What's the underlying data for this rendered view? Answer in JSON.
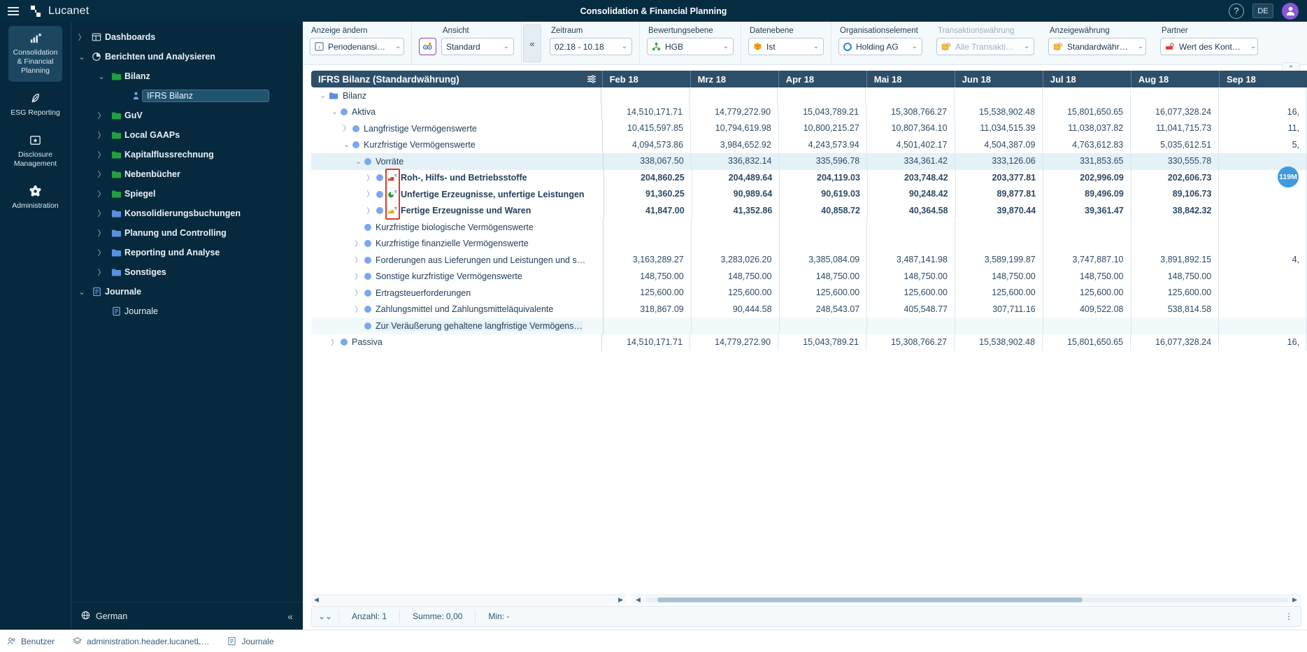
{
  "topbar": {
    "brand": "Lucanet",
    "title": "Consolidation & Financial Planning",
    "help_icon": "question-mark-icon",
    "language": "DE",
    "avatar_icon": "user-avatar-icon",
    "menu_icon": "hamburger-menu-icon"
  },
  "rail": {
    "items": [
      {
        "label": "Consolidation & Financial Planning",
        "icon": "bar-chart-icon",
        "active": true
      },
      {
        "label": "ESG Reporting",
        "icon": "leaf-icon",
        "active": false
      },
      {
        "label": "Disclosure Management",
        "icon": "document-star-icon",
        "active": false
      },
      {
        "label": "Administration",
        "icon": "gear-icon",
        "active": false
      }
    ]
  },
  "nav": {
    "items": [
      {
        "label": "Dashboards",
        "level": 1,
        "twisty": "right",
        "icon": "dashboard-icon"
      },
      {
        "label": "Berichten und Analysieren",
        "level": 1,
        "twisty": "down",
        "icon": "clock-pie-icon"
      },
      {
        "label": "Bilanz",
        "level": 2,
        "twisty": "down",
        "icon": "folder-green-icon"
      },
      {
        "label": "IFRS Bilanz",
        "level": 3,
        "twisty": "none",
        "icon": "report-person-icon",
        "selected": true
      },
      {
        "label": "GuV",
        "level": 2,
        "twisty": "right",
        "icon": "folder-green-icon"
      },
      {
        "label": "Local GAAPs",
        "level": 2,
        "twisty": "right",
        "icon": "folder-green-icon"
      },
      {
        "label": "Kapitalflussrechnung",
        "level": 2,
        "twisty": "right",
        "icon": "folder-green-icon"
      },
      {
        "label": "Nebenbücher",
        "level": 2,
        "twisty": "right",
        "icon": "folder-green-icon"
      },
      {
        "label": "Spiegel",
        "level": 2,
        "twisty": "right",
        "icon": "folder-green-icon"
      },
      {
        "label": "Konsolidierungsbuchungen",
        "level": 2,
        "twisty": "right",
        "icon": "folder-blue-icon"
      },
      {
        "label": "Planung und Controlling",
        "level": 2,
        "twisty": "right",
        "icon": "folder-blue-icon"
      },
      {
        "label": "Reporting und Analyse",
        "level": 2,
        "twisty": "right",
        "icon": "folder-blue-icon"
      },
      {
        "label": "Sonstiges",
        "level": 2,
        "twisty": "right",
        "icon": "folder-blue-icon"
      },
      {
        "label": "Journale",
        "level": 1,
        "twisty": "down",
        "icon": "journal-icon"
      },
      {
        "label": "Journale",
        "level": 2,
        "twisty": "none",
        "icon": "journal-icon",
        "leaf": true
      }
    ],
    "footer": {
      "language": "German",
      "globe_icon": "globe-icon",
      "collapse_icon": "collapse-left-icon"
    }
  },
  "toolbar": {
    "groups": [
      {
        "label": "Anzeige ändern",
        "value": "Periodenansi…",
        "icon": "table-t-icon",
        "dim": false
      },
      {
        "label": "Ansicht",
        "value": "Standard",
        "icon": "none",
        "dim": false,
        "extra_button": "view-settings-icon"
      },
      {
        "label": "Zeitraum",
        "value": "02.18 - 10.18",
        "icon": "none",
        "dim": false
      },
      {
        "label": "Bewertungsebene",
        "value": "HGB",
        "icon": "hierarchy-green-icon",
        "dim": false
      },
      {
        "label": "Datenebene",
        "value": "Ist",
        "icon": "cube-orange-icon",
        "dim": false
      },
      {
        "label": "Organisationselement",
        "value": "Holding AG",
        "icon": "circle-blue-icon",
        "dim": false
      },
      {
        "label": "Transaktionswährung",
        "value": "Alle Transakti…",
        "icon": "coins-icon",
        "dim": true
      },
      {
        "label": "Anzeigewährung",
        "value": "Standardwähr…",
        "icon": "coins-icon",
        "dim": false
      },
      {
        "label": "Partner",
        "value": "Wert des Kont…",
        "icon": "partner-red-icon",
        "dim": false
      }
    ],
    "collapse_icon": "collapse-left-icon"
  },
  "grid": {
    "tree_header": "IFRS Bilanz (Standardwährung)",
    "filter_icon": "column-settings-icon",
    "scroll_up_icon": "chevron-up-icon",
    "columns": [
      "Feb 18",
      "Mrz 18",
      "Apr 18",
      "Mai 18",
      "Jun 18",
      "Jul 18",
      "Aug 18",
      "Sep 18"
    ],
    "badge": "119M",
    "rows": [
      {
        "label": "Bilanz",
        "indent": 0,
        "twisty": "down",
        "marker": "folder",
        "bold": false,
        "values": [
          "",
          "",
          "",
          "",
          "",
          "",
          "",
          ""
        ]
      },
      {
        "label": "Aktiva",
        "indent": 1,
        "twisty": "down",
        "marker": "dot",
        "bold": false,
        "values": [
          "14,510,171.71",
          "14,779,272.90",
          "15,043,789.21",
          "15,308,766.27",
          "15,538,902.48",
          "15,801,650.65",
          "16,077,328.24",
          "16,"
        ]
      },
      {
        "label": "Langfristige Vermögenswerte",
        "indent": 2,
        "twisty": "right",
        "marker": "dot",
        "bold": false,
        "values": [
          "10,415,597.85",
          "10,794,619.98",
          "10,800,215.27",
          "10,807,364.10",
          "11,034,515.39",
          "11,038,037.82",
          "11,041,715.73",
          "11,"
        ]
      },
      {
        "label": "Kurzfristige Vermögenswerte",
        "indent": 2,
        "twisty": "down",
        "marker": "dot",
        "bold": false,
        "values": [
          "4,094,573.86",
          "3,984,652.92",
          "4,243,573.94",
          "4,501,402.17",
          "4,504,387.09",
          "4,763,612.83",
          "5,035,612.51",
          "5,"
        ]
      },
      {
        "label": "Vorräte",
        "indent": 3,
        "twisty": "down",
        "marker": "dot",
        "bold": false,
        "highlight": true,
        "values": [
          "338,067.50",
          "336,832.14",
          "335,596.78",
          "334,361.42",
          "333,126.06",
          "331,853.65",
          "330,555.78",
          ""
        ]
      },
      {
        "label": "Roh-, Hilfs- und Betriebsstoffe",
        "indent": 4,
        "twisty": "right",
        "marker": "dot",
        "mini": "chart-red-icon",
        "bold": true,
        "values": [
          "204,860.25",
          "204,489.64",
          "204,119.03",
          "203,748.42",
          "203,377.81",
          "202,996.09",
          "202,606.73",
          ""
        ]
      },
      {
        "label": "Unfertige Erzeugnisse, unfertige Leistungen",
        "indent": 4,
        "twisty": "right",
        "marker": "dot",
        "mini": "chart-green-icon",
        "bold": true,
        "values": [
          "91,360.25",
          "90,989.64",
          "90,619.03",
          "90,248.42",
          "89,877.81",
          "89,496.09",
          "89,106.73",
          ""
        ]
      },
      {
        "label": "Fertige Erzeugnisse und Waren",
        "indent": 4,
        "twisty": "right",
        "marker": "dot",
        "mini": "chart-orange-icon",
        "bold": true,
        "values": [
          "41,847.00",
          "41,352.86",
          "40,858.72",
          "40,364.58",
          "39,870.44",
          "39,361.47",
          "38,842.32",
          ""
        ]
      },
      {
        "label": "Kurzfristige biologische Vermögenswerte",
        "indent": 3,
        "twisty": "none",
        "marker": "dot",
        "bold": false,
        "values": [
          "",
          "",
          "",
          "",
          "",
          "",
          "",
          ""
        ]
      },
      {
        "label": "Kurzfristige finanzielle Vermögenswerte",
        "indent": 3,
        "twisty": "right",
        "marker": "dot",
        "bold": false,
        "values": [
          "",
          "",
          "",
          "",
          "",
          "",
          "",
          ""
        ]
      },
      {
        "label": "Forderungen aus Lieferungen und Leistungen und s…",
        "indent": 3,
        "twisty": "right",
        "marker": "dot",
        "bold": false,
        "values": [
          "3,163,289.27",
          "3,283,026.20",
          "3,385,084.09",
          "3,487,141.98",
          "3,589,199.87",
          "3,747,887.10",
          "3,891,892.15",
          "4,"
        ]
      },
      {
        "label": "Sonstige kurzfristige Vermögenswerte",
        "indent": 3,
        "twisty": "right",
        "marker": "dot",
        "bold": false,
        "values": [
          "148,750.00",
          "148,750.00",
          "148,750.00",
          "148,750.00",
          "148,750.00",
          "148,750.00",
          "148,750.00",
          ""
        ]
      },
      {
        "label": "Ertragsteuerforderungen",
        "indent": 3,
        "twisty": "right",
        "marker": "dot",
        "bold": false,
        "values": [
          "125,600.00",
          "125,600.00",
          "125,600.00",
          "125,600.00",
          "125,600.00",
          "125,600.00",
          "125,600.00",
          ""
        ]
      },
      {
        "label": "Zahlungsmittel und Zahlungsmitteläquivalente",
        "indent": 3,
        "twisty": "right",
        "marker": "dot",
        "bold": false,
        "values": [
          "318,867.09",
          "90,444.58",
          "248,543.07",
          "405,548.77",
          "307,711.16",
          "409,522.08",
          "538,814.58",
          ""
        ]
      },
      {
        "label": "Zur Veräußerung gehaltene langfristige Vermögens…",
        "indent": 3,
        "twisty": "none",
        "marker": "dot",
        "bold": false,
        "highlight2": true,
        "values": [
          "",
          "",
          "",
          "",
          "",
          "",
          "",
          ""
        ]
      },
      {
        "label": "Passiva",
        "indent": 1,
        "twisty": "right",
        "marker": "dot",
        "bold": false,
        "values": [
          "14,510,171.71",
          "14,779,272.90",
          "15,043,789.21",
          "15,308,766.27",
          "15,538,902.48",
          "15,801,650.65",
          "16,077,328.24",
          "16,"
        ]
      }
    ]
  },
  "statusbar": {
    "chevron_icon": "chevron-double-down-icon",
    "count": "Anzahl: 1",
    "sum": "Summe: 0,00",
    "min": "Min: -",
    "kebab_icon": "more-vertical-icon"
  },
  "bottombar": {
    "items": [
      {
        "label": "Benutzer",
        "icon": "users-icon"
      },
      {
        "label": "administration.header.lucanetL…",
        "icon": "layers-icon"
      },
      {
        "label": "Journale",
        "icon": "journal-icon"
      }
    ]
  },
  "colors": {
    "brand_dark": "#062c42",
    "rail_bg": "#06293d",
    "grid_header": "#2d4f69",
    "accent_blue": "#7aa7f0",
    "highlight_red": "#e03a20",
    "badge_blue": "#3f9ae0"
  }
}
